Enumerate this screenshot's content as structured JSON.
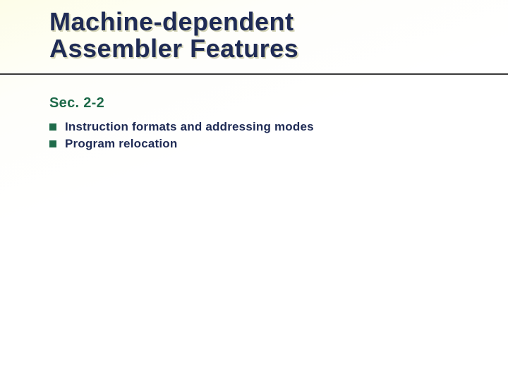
{
  "title": {
    "line1": "Machine-dependent",
    "line2": "Assembler Features"
  },
  "subheading": "Sec. 2-2",
  "bullets": [
    {
      "text": "Instruction formats and addressing modes"
    },
    {
      "text": "Program relocation"
    }
  ]
}
